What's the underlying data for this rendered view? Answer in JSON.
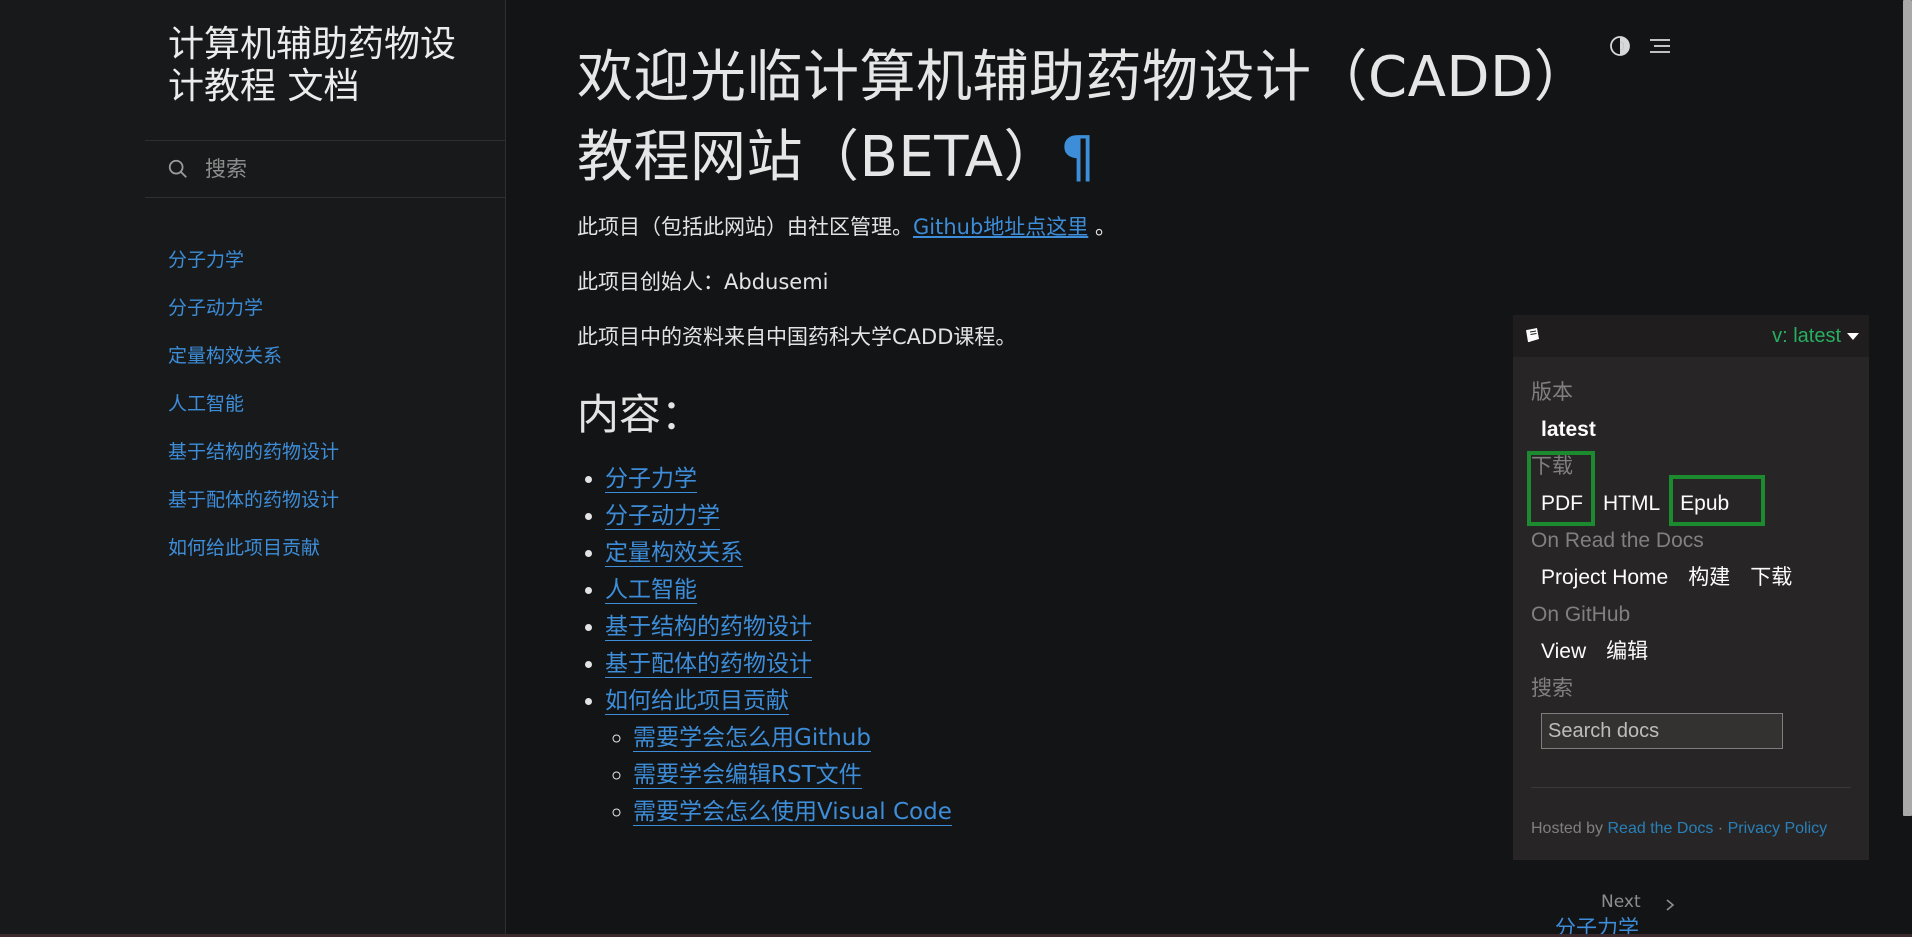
{
  "sidebar": {
    "title": "计算机辅助药物设计教程 文档",
    "search_placeholder": "搜索",
    "nav": [
      "分子力学",
      "分子动力学",
      "定量构效关系",
      "人工智能",
      "基于结构的药物设计",
      "基于配体的药物设计",
      "如何给此项目贡献"
    ]
  },
  "main": {
    "title": "欢迎光临计算机辅助药物设计（CADD）教程网站（BETA）",
    "headerlink": "¶",
    "para1_prefix": "此项目（包括此网站）由社区管理。",
    "para1_link": "Github地址点这里",
    "para1_suffix": " 。",
    "para2": "此项目创始人：Abdusemi",
    "para3": "此项目中的资料来自中国药科大学CADD课程。",
    "contents_heading": "内容：",
    "toc": [
      "分子力学",
      "分子动力学",
      "定量构效关系",
      "人工智能",
      "基于结构的药物设计",
      "基于配体的药物设计",
      "如何给此项目贡献"
    ],
    "toc_sub": [
      "需要学会怎么用Github",
      "需要学会编辑RST文件",
      "需要学会怎么使用Visual Code"
    ]
  },
  "rtd": {
    "version_label": "v: latest",
    "versions_title": "版本",
    "version_latest": "latest",
    "downloads_title": "下载",
    "downloads": [
      "PDF",
      "HTML",
      "Epub"
    ],
    "on_rtd_title": "On Read the Docs",
    "on_rtd_links": [
      "Project Home",
      "构建",
      "下载"
    ],
    "on_github_title": "On GitHub",
    "on_github_links": [
      "View",
      "编辑"
    ],
    "search_title": "搜索",
    "search_placeholder": "Search docs",
    "hosted_by": "Hosted by",
    "hosted_link": "Read the Docs",
    "separator": "·",
    "privacy": "Privacy Policy"
  },
  "next": {
    "label": "Next",
    "title": "分子力学"
  },
  "colors": {
    "link": "#3d8dd8",
    "rtd_green": "#27ae60",
    "highlight": "#1c8a2e"
  }
}
